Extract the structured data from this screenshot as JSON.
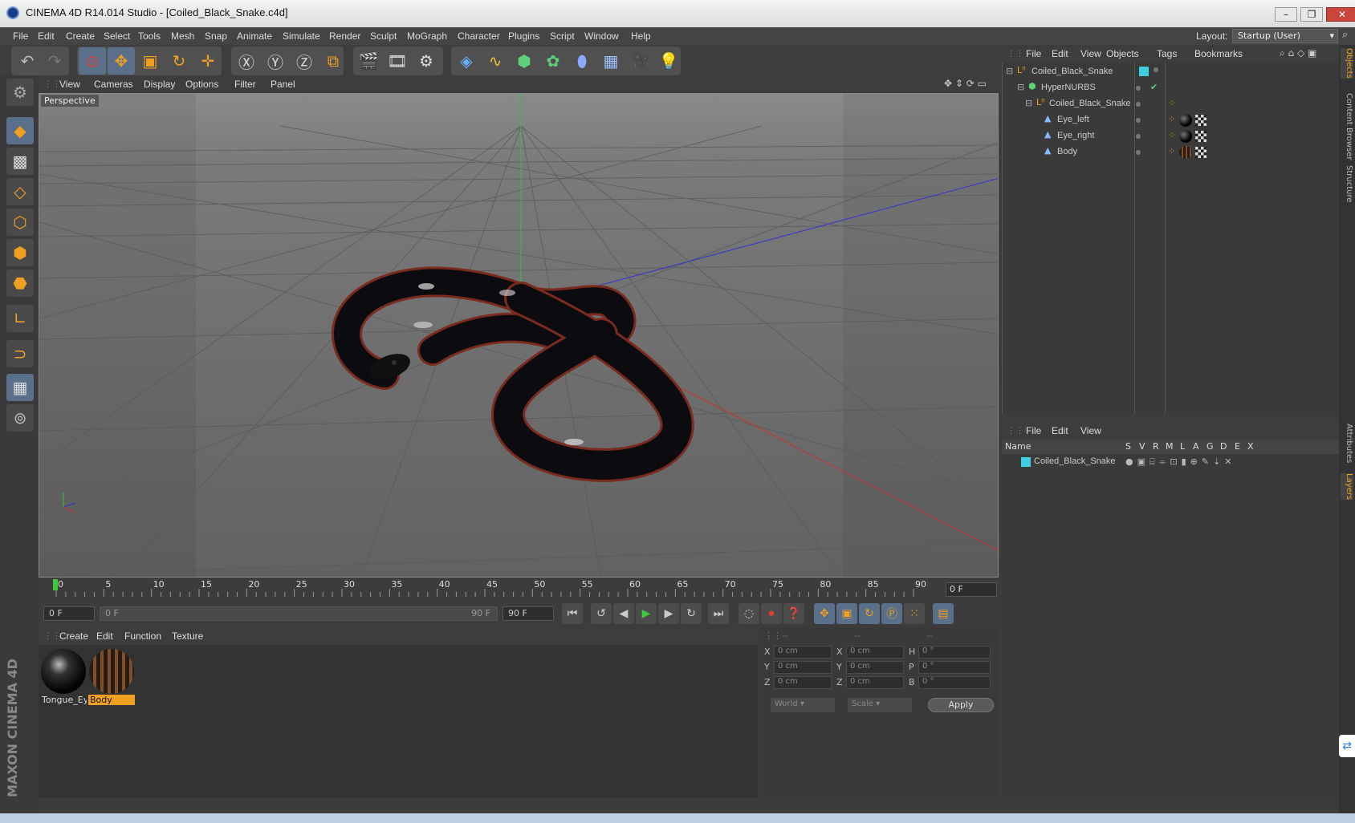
{
  "window": {
    "title": "CINEMA 4D R14.014 Studio - [Coiled_Black_Snake.c4d]"
  },
  "menus": [
    "File",
    "Edit",
    "Create",
    "Select",
    "Tools",
    "Mesh",
    "Snap",
    "Animate",
    "Simulate",
    "Render",
    "Sculpt",
    "MoGraph",
    "Character",
    "Plugins",
    "Script",
    "Window",
    "Help"
  ],
  "layout": {
    "label": "Layout:",
    "value": "Startup (User)"
  },
  "viewport": {
    "menus": [
      "View",
      "Cameras",
      "Display",
      "Options",
      "Filter",
      "Panel"
    ],
    "label": "Perspective"
  },
  "timeline": {
    "ticks": [
      "0",
      "5",
      "10",
      "15",
      "20",
      "25",
      "30",
      "35",
      "40",
      "45",
      "50",
      "55",
      "60",
      "65",
      "70",
      "75",
      "80",
      "85",
      "90"
    ],
    "current_frame": "0 F",
    "start_field": "0 F",
    "range_start": "0 F",
    "range_end": "90 F",
    "end_field": "90 F"
  },
  "materials": {
    "menus": [
      "Create",
      "Edit",
      "Function",
      "Texture"
    ],
    "items": [
      {
        "name": "Tongue_Ey",
        "selected": false
      },
      {
        "name": "Body",
        "selected": true
      }
    ]
  },
  "coordinates": {
    "headers": [
      "--",
      "--",
      "--"
    ],
    "rows": [
      {
        "l1": "X",
        "v1": "0 cm",
        "l2": "X",
        "v2": "0 cm",
        "l3": "H",
        "v3": "0 °"
      },
      {
        "l1": "Y",
        "v1": "0 cm",
        "l2": "Y",
        "v2": "0 cm",
        "l3": "P",
        "v3": "0 °"
      },
      {
        "l1": "Z",
        "v1": "0 cm",
        "l2": "Z",
        "v2": "0 cm",
        "l3": "B",
        "v3": "0 °"
      }
    ],
    "mode": "World",
    "scale": "Scale",
    "apply": "Apply"
  },
  "objects": {
    "menus": [
      "File",
      "Edit",
      "View",
      "Objects",
      "Tags",
      "Bookmarks"
    ],
    "tree": [
      {
        "name": "Coiled_Black_Snake",
        "indent": 0
      },
      {
        "name": "HyperNURBS",
        "indent": 1
      },
      {
        "name": "Coiled_Black_Snake",
        "indent": 2
      },
      {
        "name": "Eye_left",
        "indent": 3
      },
      {
        "name": "Eye_right",
        "indent": 3
      },
      {
        "name": "Body",
        "indent": 3
      }
    ]
  },
  "layers": {
    "menus": [
      "File",
      "Edit",
      "View"
    ],
    "columns": [
      "Name",
      "S",
      "V",
      "R",
      "M",
      "L",
      "A",
      "G",
      "D",
      "E",
      "X"
    ],
    "items": [
      {
        "name": "Coiled_Black_Snake",
        "color": "#3fd0e0"
      }
    ]
  },
  "right_tabs": [
    "Objects",
    "Content Browser",
    "Structure",
    "Attributes",
    "Layers"
  ],
  "branding": "MAXON CINEMA 4D",
  "colors": {
    "accent": "#f0a020",
    "selection": "#5a6f8a",
    "layer_color": "#3fd0e0"
  }
}
